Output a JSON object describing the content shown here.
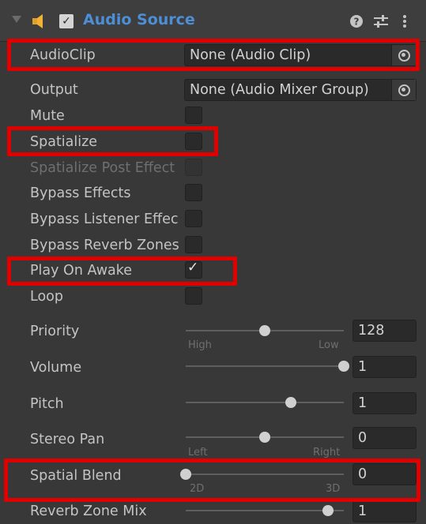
{
  "header": {
    "title": "Audio Source",
    "enabled_check": "✓",
    "help_icon": "help-icon",
    "presets_icon": "presets-icon",
    "menu_icon": "kebab-menu-icon",
    "accent_color": "#4d8fd6"
  },
  "fields": {
    "audioclip": {
      "label": "AudioClip",
      "value": "None (Audio Clip)"
    },
    "output": {
      "label": "Output",
      "value": "None (Audio Mixer Group)"
    },
    "mute": {
      "label": "Mute"
    },
    "spatialize": {
      "label": "Spatialize"
    },
    "spatialize_post_effects": {
      "label": "Spatialize Post Effect"
    },
    "bypass_effects": {
      "label": "Bypass Effects"
    },
    "bypass_listener_effects": {
      "label": "Bypass Listener Effec"
    },
    "bypass_reverb_zones": {
      "label": "Bypass Reverb Zones"
    },
    "play_on_awake": {
      "label": "Play On Awake",
      "check": "✓"
    },
    "loop": {
      "label": "Loop"
    },
    "priority": {
      "label": "Priority",
      "value": "128",
      "left": "High",
      "right": "Low",
      "fraction": 0.5
    },
    "volume": {
      "label": "Volume",
      "value": "1",
      "fraction": 1.0
    },
    "pitch": {
      "label": "Pitch",
      "value": "1",
      "fraction": 0.667
    },
    "stereo_pan": {
      "label": "Stereo Pan",
      "value": "0",
      "left": "Left",
      "right": "Right",
      "fraction": 0.5
    },
    "spatial_blend": {
      "label": "Spatial Blend",
      "value": "0",
      "left": "2D",
      "right": "3D",
      "fraction": 0.0
    },
    "reverb_zone_mix": {
      "label": "Reverb Zone Mix",
      "value": "1",
      "fraction": 0.9
    }
  },
  "highlight_color": "#e00000"
}
